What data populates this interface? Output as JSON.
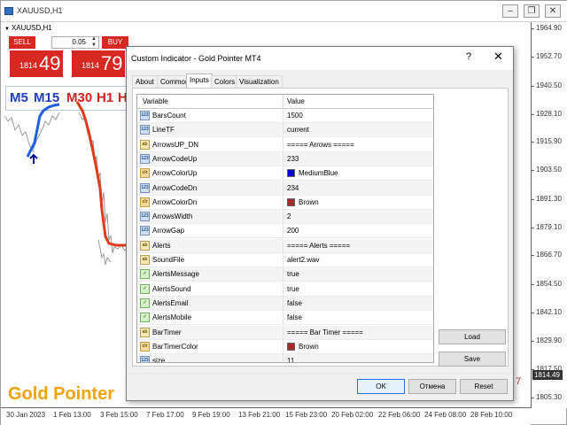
{
  "chart": {
    "title": "XAUUSD,H1",
    "label": "XAUUSD,H1",
    "window_buttons": [
      "–",
      "❐",
      "✕"
    ],
    "trade": {
      "sell_label": "SELL",
      "buy_label": "BUY",
      "volume": "0.05",
      "bid_small": "1814",
      "bid_big": "49",
      "ask_small": "1814",
      "ask_big": "79"
    },
    "timeframes": [
      {
        "label": "M5",
        "color": "#1f3fbf"
      },
      {
        "label": "M15",
        "color": "#1f3fbf"
      },
      {
        "label": "M30",
        "color": "#d02020"
      },
      {
        "label": "H1",
        "color": "#d02020"
      },
      {
        "label": "H",
        "color": "#d02020"
      }
    ],
    "indicator_name": "Gold Pointer",
    "price_ticks": [
      "1964.90",
      "1952.70",
      "1940.50",
      "1928.10",
      "1915.90",
      "1903.50",
      "1891.30",
      "1879.10",
      "1866.70",
      "1854.50",
      "1842.10",
      "1829.90",
      "1817.50",
      "1805.30"
    ],
    "current_price": "1814.49",
    "time_ticks": [
      "30 Jan 2023",
      "1 Feb 13:00",
      "3 Feb 15:00",
      "7 Feb 17:00",
      "9 Feb 19:00",
      "13 Feb 21:00",
      "15 Feb 23:00",
      "20 Feb 02:00",
      "22 Feb 06:00",
      "24 Feb 08:00",
      "28 Feb 10:00"
    ],
    "red_mark": "7",
    "colors": {
      "sell": "#d72822",
      "buy": "#d72822",
      "up_line": "#2060e0",
      "down_line": "#e03a1a",
      "indicator_text": "#f0a30a"
    }
  },
  "dialog": {
    "title": "Custom Indicator - Gold Pointer MT4",
    "help": "?",
    "close": "✕",
    "tabs": [
      "About",
      "Common",
      "Inputs",
      "Colors",
      "Visualization"
    ],
    "active_tab": "Inputs",
    "columns": {
      "variable": "Variable",
      "value": "Value"
    },
    "params": [
      {
        "name": "BarsCount",
        "value": "1500",
        "type": "int",
        "icon": "123"
      },
      {
        "name": "LineTF",
        "value": "current",
        "type": "tf",
        "icon": "123"
      },
      {
        "name": "ArrowsUP_DN",
        "value": "===== Arrows =====",
        "type": "str",
        "icon": "ab"
      },
      {
        "name": "ArrowCodeUp",
        "value": "233",
        "type": "int",
        "icon": "123"
      },
      {
        "name": "ArrowColorUp",
        "value": "MediumBlue",
        "type": "color",
        "icon": "clr",
        "swatch": "#0000cd"
      },
      {
        "name": "ArrowCodeDn",
        "value": "234",
        "type": "int",
        "icon": "123"
      },
      {
        "name": "ArrowColorDn",
        "value": "Brown",
        "type": "color",
        "icon": "clr",
        "swatch": "#a52a2a"
      },
      {
        "name": "ArrowsWidth",
        "value": "2",
        "type": "int",
        "icon": "123"
      },
      {
        "name": "ArrowGap",
        "value": "200",
        "type": "int",
        "icon": "123"
      },
      {
        "name": "Alerts",
        "value": "===== Alerts =====",
        "type": "str",
        "icon": "ab"
      },
      {
        "name": "SoundFile",
        "value": "alert2.wav",
        "type": "str",
        "icon": "ab"
      },
      {
        "name": "AlertsMessage",
        "value": "true",
        "type": "bool",
        "icon": "✓"
      },
      {
        "name": "AlertsSound",
        "value": "true",
        "type": "bool",
        "icon": "✓"
      },
      {
        "name": "AlertsEmail",
        "value": "false",
        "type": "bool",
        "icon": "✓"
      },
      {
        "name": "AlertsMobile",
        "value": "false",
        "type": "bool",
        "icon": "✓"
      },
      {
        "name": "BarTimer",
        "value": "===== Bar Timer =====",
        "type": "str",
        "icon": "ab"
      },
      {
        "name": "BarTimerColor",
        "value": "Brown",
        "type": "color",
        "icon": "clr",
        "swatch": "#a52a2a"
      },
      {
        "name": "size",
        "value": "11",
        "type": "int",
        "icon": "123"
      }
    ],
    "load_label": "Load",
    "save_label": "Save",
    "ok_label": "OK",
    "cancel_label": "Отмена",
    "reset_label": "Reset"
  }
}
